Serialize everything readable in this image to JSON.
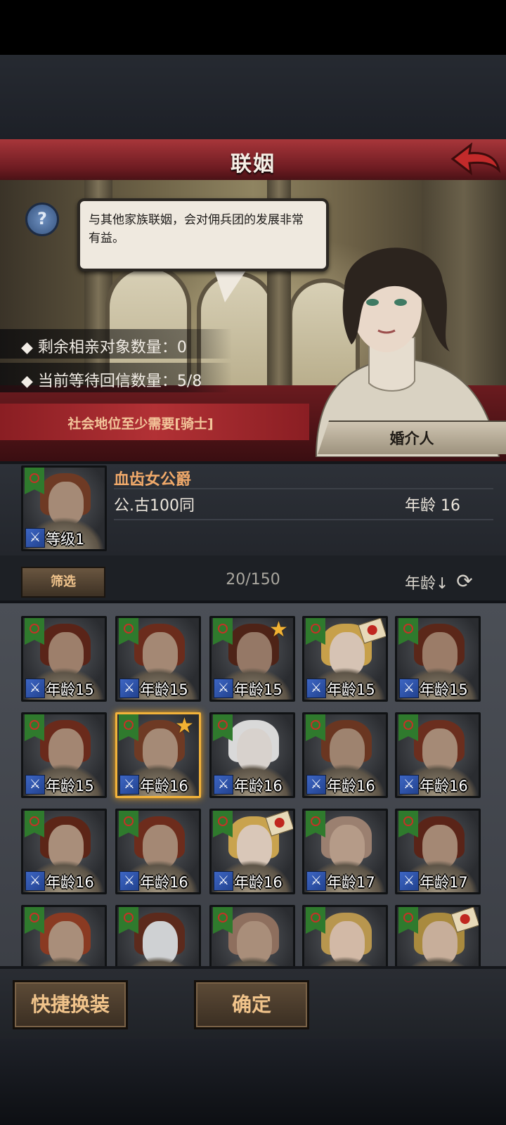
{
  "header": {
    "title": "联姻"
  },
  "scene": {
    "speech": "与其他家族联姻，会对佣兵团的发展非常有益。",
    "stats": [
      {
        "label": "◆ 剩余相亲对象数量：0"
      },
      {
        "label": "◆ 当前等待回信数量：5/8"
      }
    ],
    "requirement": "社会地位至少需要[骑士]",
    "npc_role": "婚介人"
  },
  "selected": {
    "name": "血齿女公爵",
    "clan": "公.古100同",
    "age_text": "年龄 16",
    "level_text": "等级1"
  },
  "filter": {
    "filter_label": "筛选",
    "count": "20/150",
    "sort_label": "年龄↓"
  },
  "candidates": [
    {
      "age": "年龄15",
      "hair": "#5a2418",
      "skin": "#9d7f6b",
      "badge": ""
    },
    {
      "age": "年龄15",
      "hair": "#6b2c1c",
      "skin": "#a48874",
      "badge": ""
    },
    {
      "age": "年龄15",
      "hair": "#4e2317",
      "skin": "#957866",
      "badge": "star"
    },
    {
      "age": "年龄15",
      "hair": "#c7a04a",
      "skin": "#d6c3b4",
      "badge": "seal"
    },
    {
      "age": "年龄15",
      "hair": "#5b2719",
      "skin": "#9b7c68",
      "badge": ""
    },
    {
      "age": "年龄15",
      "hair": "#6a2a1b",
      "skin": "#a38672",
      "badge": ""
    },
    {
      "age": "年龄16",
      "hair": "#6e3a24",
      "skin": "#a58a76",
      "badge": "star",
      "selected": true
    },
    {
      "age": "年龄16",
      "hair": "#d9d9d9",
      "skin": "#d8d2cd",
      "badge": ""
    },
    {
      "age": "年龄16",
      "hair": "#6a3621",
      "skin": "#9e836f",
      "badge": ""
    },
    {
      "age": "年龄16",
      "hair": "#6b2e1e",
      "skin": "#a58a76",
      "badge": ""
    },
    {
      "age": "年龄16",
      "hair": "#5c2517",
      "skin": "#a98e7a",
      "badge": ""
    },
    {
      "age": "年龄16",
      "hair": "#6d2c1c",
      "skin": "#a48874",
      "badge": ""
    },
    {
      "age": "年龄16",
      "hair": "#c9a34e",
      "skin": "#d9c7b8",
      "badge": "seal"
    },
    {
      "age": "年龄17",
      "hair": "#9b8070",
      "skin": "#b59b88",
      "badge": ""
    },
    {
      "age": "年龄17",
      "hair": "#5a2418",
      "skin": "#a48874",
      "badge": ""
    },
    {
      "age": "",
      "hair": "#8a3a22",
      "skin": "#a98e7a",
      "badge": ""
    },
    {
      "age": "",
      "hair": "#5c2a1c",
      "skin": "#cfd1d3",
      "badge": ""
    },
    {
      "age": "",
      "hair": "#8e6f5e",
      "skin": "#a98e7a",
      "badge": ""
    },
    {
      "age": "",
      "hair": "#b8964e",
      "skin": "#d2b9a6",
      "badge": ""
    },
    {
      "age": "",
      "hair": "#a98a3e",
      "skin": "#c7ae9a",
      "badge": "seal"
    }
  ],
  "actions": {
    "quick_equip": "快捷换装",
    "confirm": "确定"
  }
}
